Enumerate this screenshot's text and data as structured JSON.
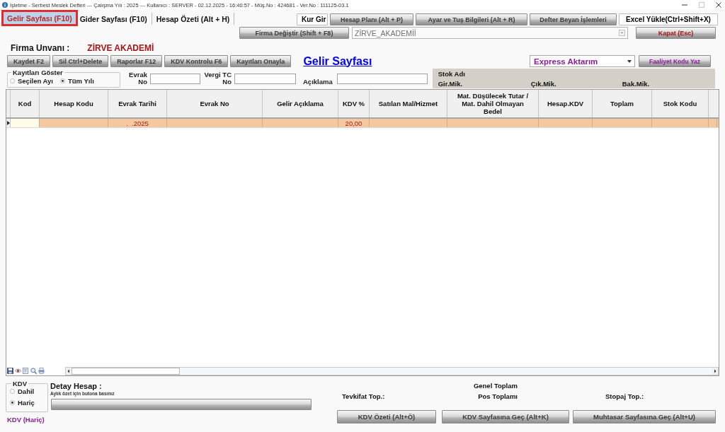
{
  "window": {
    "title": "İşletme - Serbest Meslek Defteri --- Çalışma Yılı : 2025 --- Kullanıcı : SERVER - 02.12.2025 - 16:40:57 - Müş.No : 424681 - Ver.No : 111125-03.1"
  },
  "tabs": [
    {
      "label": "Gelir Sayfası (F10)",
      "selected": true
    },
    {
      "label": "Gider Sayfası (F10)",
      "selected": false
    },
    {
      "label": "Hesap Özeti (Alt + H)",
      "selected": false
    }
  ],
  "toolbar": [
    {
      "label": "Kur Gir",
      "kind": "flat"
    },
    {
      "label": "Hesap Planı (Alt + P)",
      "kind": "raised"
    },
    {
      "label": "Ayar ve Tuş Bilgileri (Alt + R)",
      "kind": "raised"
    },
    {
      "label": "Defter Beyan İşlemleri",
      "kind": "raised"
    },
    {
      "label": "Excel Yükle(Ctrl+Shift+X)",
      "kind": "flat"
    }
  ],
  "company_bar": {
    "switch_button": "Firma Değiştir (Shift + F8)",
    "company": "ZİRVE_AKADEMİİ",
    "close_button": "Kapat (Esc)"
  },
  "firm": {
    "label": "Firma Unvanı :",
    "name": "ZİRVE AKADEMİ"
  },
  "actions": [
    "Kaydet F2",
    "Sil Ctrl+Delete",
    "Raporlar F12",
    "KDV Kontrolu F6",
    "Kayıtları Onayla"
  ],
  "page_link": "Gelir Sayfası",
  "transfer": {
    "value": "Express Aktarım",
    "button": "Faaliyet Kodu Yaz"
  },
  "show_records": {
    "title": "Kayıtları Göster",
    "options": [
      {
        "label": "Seçilen Ayı",
        "selected": false
      },
      {
        "label": "Tüm Yılı",
        "selected": true
      }
    ]
  },
  "filters": [
    {
      "label": "Evrak No"
    },
    {
      "label": "Vergi TC No"
    },
    {
      "label": "Açıklama"
    }
  ],
  "stock_panel": {
    "title": "Stok Adı",
    "fields": [
      "Gir.Mik.",
      "Çık.Mik.",
      "Bak.Mik."
    ]
  },
  "table": {
    "columns": [
      "Kod",
      "Hesap Kodu",
      "Evrak Tarihi",
      "Evrak No",
      "Gelir Açıklama",
      "KDV %",
      "Satılan Mal/Hizmet",
      "Mat. Düşülecek Tutar / Mat. Dahil Olmayan Bedel",
      "Hesap.KDV",
      "Toplam",
      "Stok Kodu"
    ],
    "rows": [
      {
        "selected": true,
        "date": ".  .2025",
        "vat_rate": "20,00"
      }
    ]
  },
  "vat_mode": {
    "title": "KDV",
    "options": [
      {
        "label": "Dahil",
        "selected": false
      },
      {
        "label": "Hariç",
        "selected": true
      }
    ],
    "status": "KDV (Hariç)"
  },
  "detail": {
    "title": "Detay Hesap :",
    "hint": "Aylık özet için butona basınız"
  },
  "totals": {
    "general": "Genel Toplam",
    "withholding": "Tevkifat Top.:",
    "pos": "Pos Toplamı",
    "stoppage": "Stopaj Top.:"
  },
  "footer_buttons": [
    "KDV Özeti (Alt+Ö)",
    "KDV Sayfasına Geç (Alt+K)",
    "Muhtasar Sayfasına Geç (Alt+U)"
  ]
}
